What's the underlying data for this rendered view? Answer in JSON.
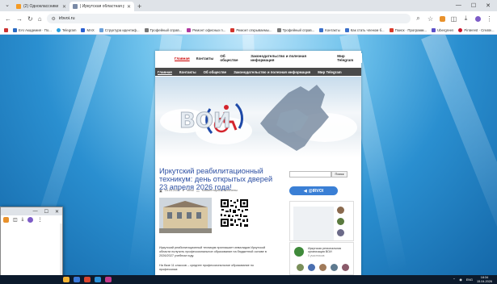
{
  "browser": {
    "tab_inactive_label": "(2) Одноклассники",
    "tab_active_label": "| Иркутская областная реаби...",
    "new_tab": "+",
    "url": "irbvoi.ru",
    "min": "—",
    "max": "☐",
    "close": "✕"
  },
  "bookmarks": [
    "Все закладки",
    "EAI Академия · По...",
    "Telegram",
    "MAX",
    "Структура идентиф...",
    "Трофейный справ...",
    "Ремонт офисных п...",
    "Ремонт открываемы...",
    "Трофейный справ...",
    "Контакты",
    "Как стать членом б...",
    "Поиск · Программ...",
    "Ubergreen",
    "Pinterest · Create..."
  ],
  "site": {
    "top_menu": [
      "Главная",
      "Контакты",
      "Об обществе",
      "Законодательство и полезная информация",
      "Мир Telegram"
    ],
    "dark_menu": [
      "Главная",
      "Контакты",
      "Об обществе",
      "Законодательство и полезная информация",
      "Мир Telegram"
    ],
    "logo_text": "ВОИ",
    "article_title": "Иркутский реабилитационный техникум: день открытых дверей 23 апреля 2026 года!",
    "meta_date": "16.04.2026",
    "meta_author": "irbvoi",
    "meta_comments": "Комментарии отключены",
    "paragraphs": [
      "Иркутский реабилитационный техникум приглашает инвалидов Иркутской области получить профессиональное образование на бюджетной основе в 2026/2027 учебном году.",
      "На базе 11 классов – среднее профессиональное образование по профессиям:"
    ],
    "search_button": "Поиск",
    "vk_button": "@IRVOI",
    "widget2_text": "Иркутская региональная организация ВОИ",
    "widget2_sub": "5 участников"
  },
  "taskbar": {
    "lang": "ENG",
    "time": "18:34",
    "date": "15.04.2026"
  },
  "colors": {
    "link": "#2c4fa3",
    "vk": "#3a7fd5",
    "menu_dark": "#4a4a4a"
  }
}
